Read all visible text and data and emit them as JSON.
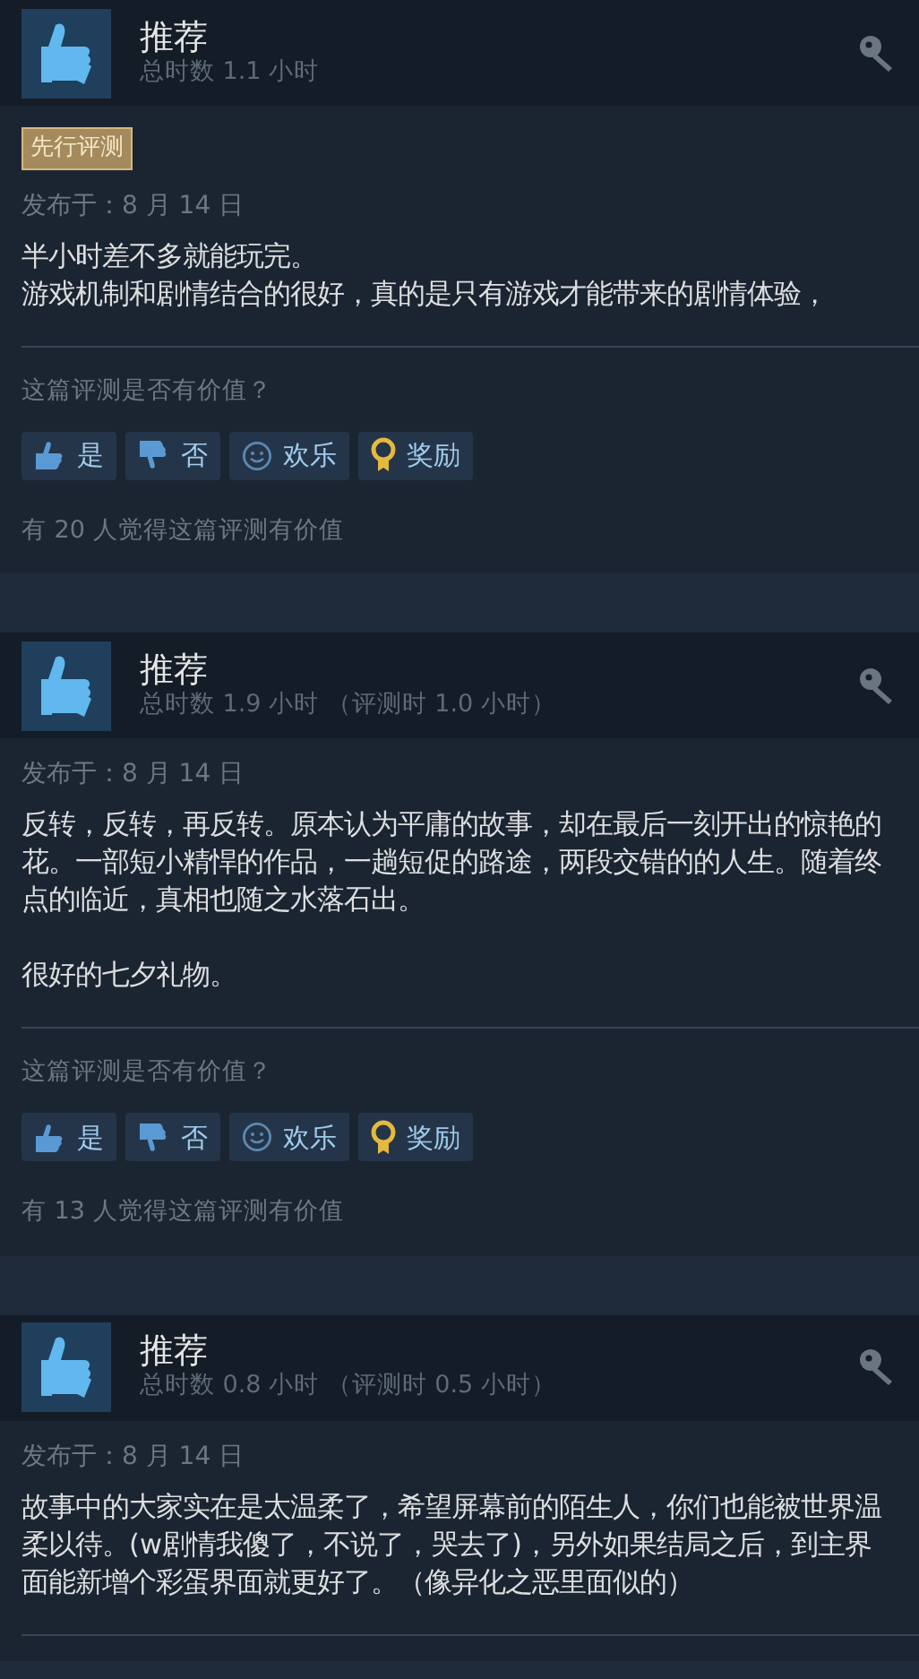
{
  "reviews": [
    {
      "title": "推荐",
      "hours": "总时数 1.1 小时",
      "badge": "先行评测",
      "date": "发布于：8 月 14 日",
      "body": [
        [
          "半小时差不多就能玩完。",
          "游戏机制和剧情结合的很好，真的是只有游戏才能带来的剧情体验，"
        ]
      ],
      "question": "这篇评测是否有价值？",
      "buttons": [
        {
          "kind": "yes",
          "label": "是"
        },
        {
          "kind": "no",
          "label": "否"
        },
        {
          "kind": "funny",
          "label": "欢乐"
        },
        {
          "kind": "award",
          "label": "奖励"
        }
      ],
      "helpful": "有 20 人觉得这篇评测有价值"
    },
    {
      "title": "推荐",
      "hours": "总时数 1.9 小时 （评测时 1.0 小时）",
      "date": "发布于：8 月 14 日",
      "body": [
        [
          "反转，反转，再反转。原本认为平庸的故事，却在最后一刻开出的惊艳的花。一部短小精悍的作品，一趟短促的路途，两段交错的的人生。随着终点的临近，真相也随之水落石出。"
        ],
        [
          "很好的七夕礼物。"
        ]
      ],
      "question": "这篇评测是否有价值？",
      "buttons": [
        {
          "kind": "yes",
          "label": "是"
        },
        {
          "kind": "no",
          "label": "否"
        },
        {
          "kind": "funny",
          "label": "欢乐"
        },
        {
          "kind": "award",
          "label": "奖励"
        }
      ],
      "helpful": "有 13 人觉得这篇评测有价值"
    },
    {
      "title": "推荐",
      "hours": "总时数 0.8 小时 （评测时 0.5 小时）",
      "date": "发布于：8 月 14 日",
      "body": [
        [
          "故事中的大家实在是太温柔了，希望屏幕前的陌生人，你们也能被世界温柔以待。(w剧情我傻了，不说了，哭去了)，另外如果结局之后，到主界面能新增个彩蛋界面就更好了。（像异化之恶里面似的）"
        ]
      ]
    }
  ]
}
